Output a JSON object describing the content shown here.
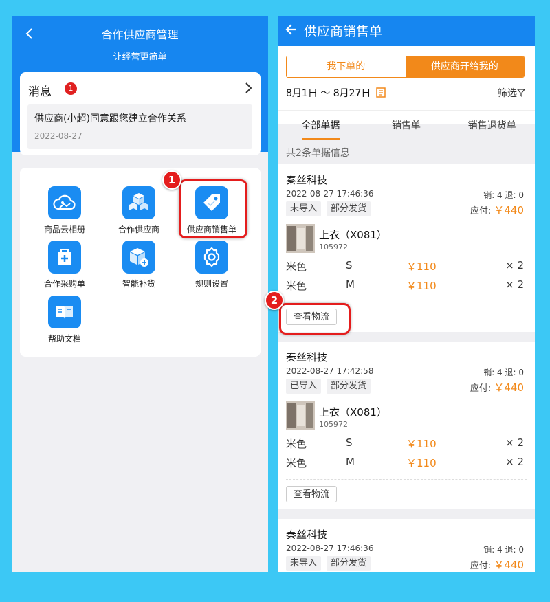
{
  "left": {
    "title": "合作供应商管理",
    "subtitle": "让经营更简单",
    "message": {
      "title": "消息",
      "badge": "1",
      "text": "供应商(小超)同意跟您建立合作关系",
      "date": "2022-08-27"
    },
    "grid": [
      {
        "label": "商品云相册",
        "icon": "cloud-album-icon"
      },
      {
        "label": "合作供应商",
        "icon": "supplier-cubes-icon"
      },
      {
        "label": "供应商销售单",
        "icon": "price-tag-icon"
      },
      {
        "label": "合作采购单",
        "icon": "purchase-bag-icon"
      },
      {
        "label": "智能补货",
        "icon": "restock-box-icon"
      },
      {
        "label": "规则设置",
        "icon": "gear-icon"
      },
      {
        "label": "帮助文档",
        "icon": "help-book-icon"
      }
    ]
  },
  "callouts": [
    "1",
    "2"
  ],
  "right": {
    "title": "供应商销售单",
    "segments": [
      "我下单的",
      "供应商开给我的"
    ],
    "date_range": "8月1日 ～ 8月27日",
    "filter_label": "筛选",
    "tabs": [
      "全部单据",
      "销售单",
      "销售退货单"
    ],
    "count_text": "共2条单据信息",
    "orders": [
      {
        "company": "秦丝科技",
        "time": "2022-08-27 17:46:36",
        "counts": "销: 4   退: 0",
        "tags": [
          "未导入",
          "部分发货"
        ],
        "pay_label": "应付: ",
        "pay_amount": "￥440",
        "product": "上衣（X081）",
        "code": "105972",
        "lines": [
          {
            "color": "米色",
            "size": "S",
            "price": "￥110",
            "qty": "× 2"
          },
          {
            "color": "米色",
            "size": "M",
            "price": "￥110",
            "qty": "× 2"
          }
        ],
        "logistics": "查看物流"
      },
      {
        "company": "秦丝科技",
        "time": "2022-08-27 17:42:58",
        "counts": "销: 4   退: 0",
        "tags": [
          "已导入",
          "部分发货"
        ],
        "pay_label": "应付: ",
        "pay_amount": "￥440",
        "product": "上衣（X081）",
        "code": "105972",
        "lines": [
          {
            "color": "米色",
            "size": "S",
            "price": "￥110",
            "qty": "× 2"
          },
          {
            "color": "米色",
            "size": "M",
            "price": "￥110",
            "qty": "× 2"
          }
        ],
        "logistics": "查看物流"
      },
      {
        "company": "秦丝科技",
        "time": "2022-08-27 17:46:36",
        "counts": "销: 4   退: 0",
        "tags": [
          "未导入",
          "部分发货"
        ],
        "pay_label": "应付: ",
        "pay_amount": "￥440"
      }
    ]
  }
}
